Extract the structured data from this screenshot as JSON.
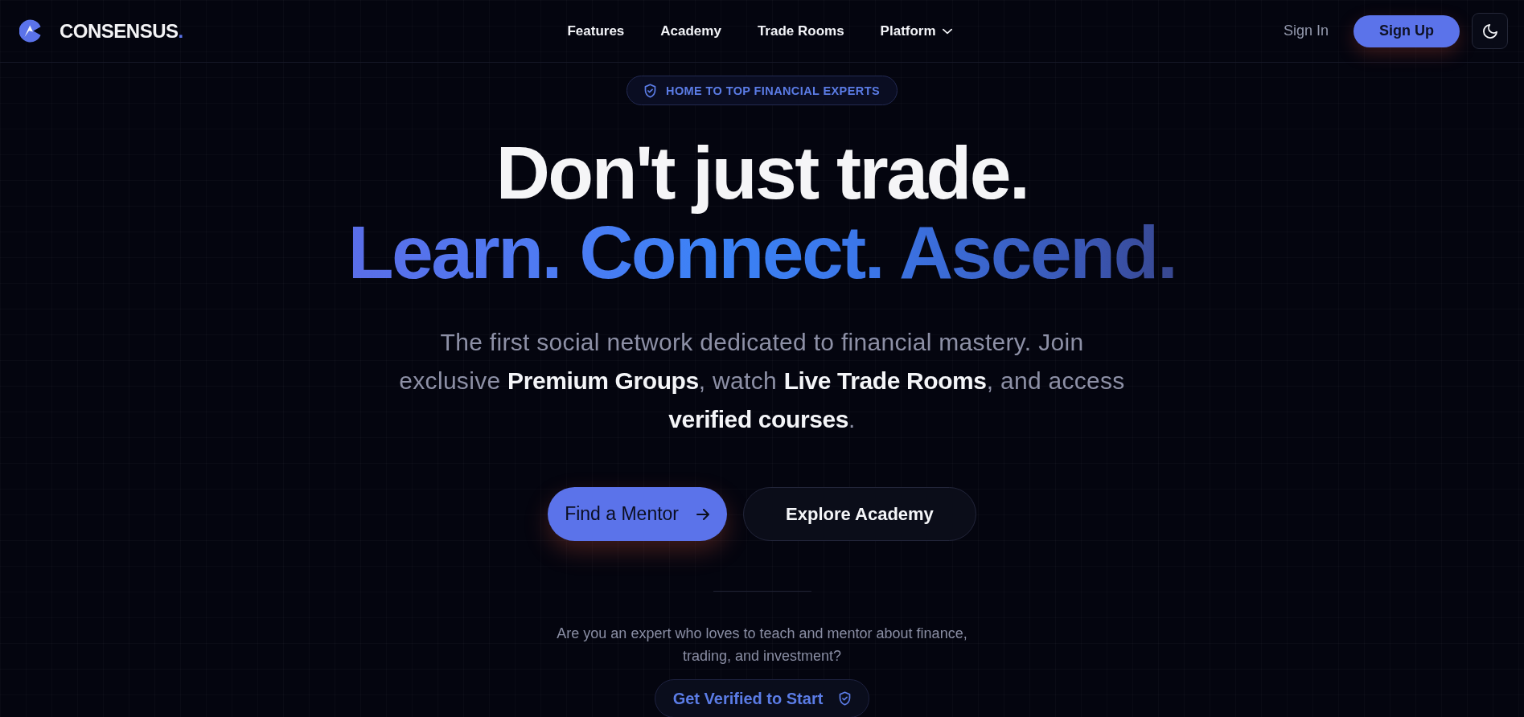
{
  "nav": {
    "brand": {
      "name": "CONSENSUS",
      "suffix": "."
    },
    "links": [
      {
        "label": "Features",
        "kind": "link"
      },
      {
        "label": "Academy",
        "kind": "link"
      },
      {
        "label": "Trade Rooms",
        "kind": "link"
      },
      {
        "label": "Platform",
        "kind": "dropdown"
      }
    ],
    "sign_in": "Sign In",
    "sign_up": "Sign Up"
  },
  "hero": {
    "badge": "HOME TO TOP FINANCIAL EXPERTS",
    "headline": "Don't just trade.",
    "headline_accent": "Learn. Connect. Ascend.",
    "intro": "The first social network dedicated to financial mastery. Join exclusive **Premium Groups**, watch **Live Trade Rooms**, and access **verified courses**.",
    "actions": [
      {
        "label": "Find a Mentor",
        "kind": "primary"
      },
      {
        "label": "Explore Academy",
        "kind": "secondary"
      }
    ]
  },
  "experts": {
    "question": "Are you an expert who loves to teach and mentor about finance, trading, and investment?",
    "button": "Get Verified to Start"
  }
}
